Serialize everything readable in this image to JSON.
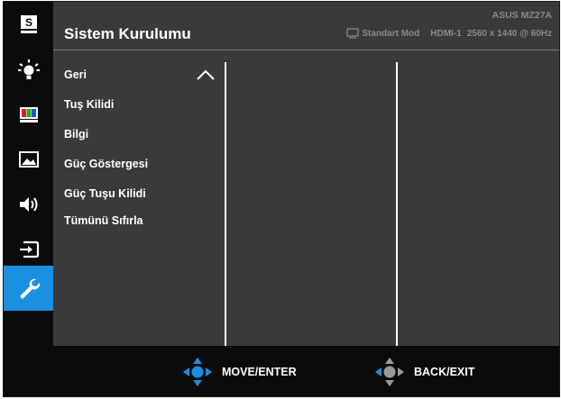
{
  "header": {
    "title": "Sistem Kurulumu",
    "model": "ASUS MZ27A",
    "mode": "Standart Mod",
    "input": "HDMI-1",
    "resolution": "2560 x 1440 @ 60Hz"
  },
  "sidebar": {
    "items": [
      {
        "icon": "splendid-s-icon"
      },
      {
        "icon": "blue-light-icon"
      },
      {
        "icon": "color-icon"
      },
      {
        "icon": "image-icon"
      },
      {
        "icon": "sound-icon"
      },
      {
        "icon": "input-select-icon"
      },
      {
        "icon": "wrench-icon",
        "active": true
      }
    ]
  },
  "menu": {
    "items": [
      {
        "label": "Geri"
      },
      {
        "label": "Tuş Kilidi"
      },
      {
        "label": "Bilgi"
      },
      {
        "label": "Güç Göstergesi"
      },
      {
        "label": "Güç Tuşu Kilidi"
      },
      {
        "label": "Tümünü Sıfırla"
      }
    ]
  },
  "footer": {
    "move_label": "MOVE/ENTER",
    "back_label": "BACK/EXIT"
  },
  "colors": {
    "accent": "#1b8fe0",
    "panel": "#3a3a3a",
    "background": "#0b0b0b"
  }
}
